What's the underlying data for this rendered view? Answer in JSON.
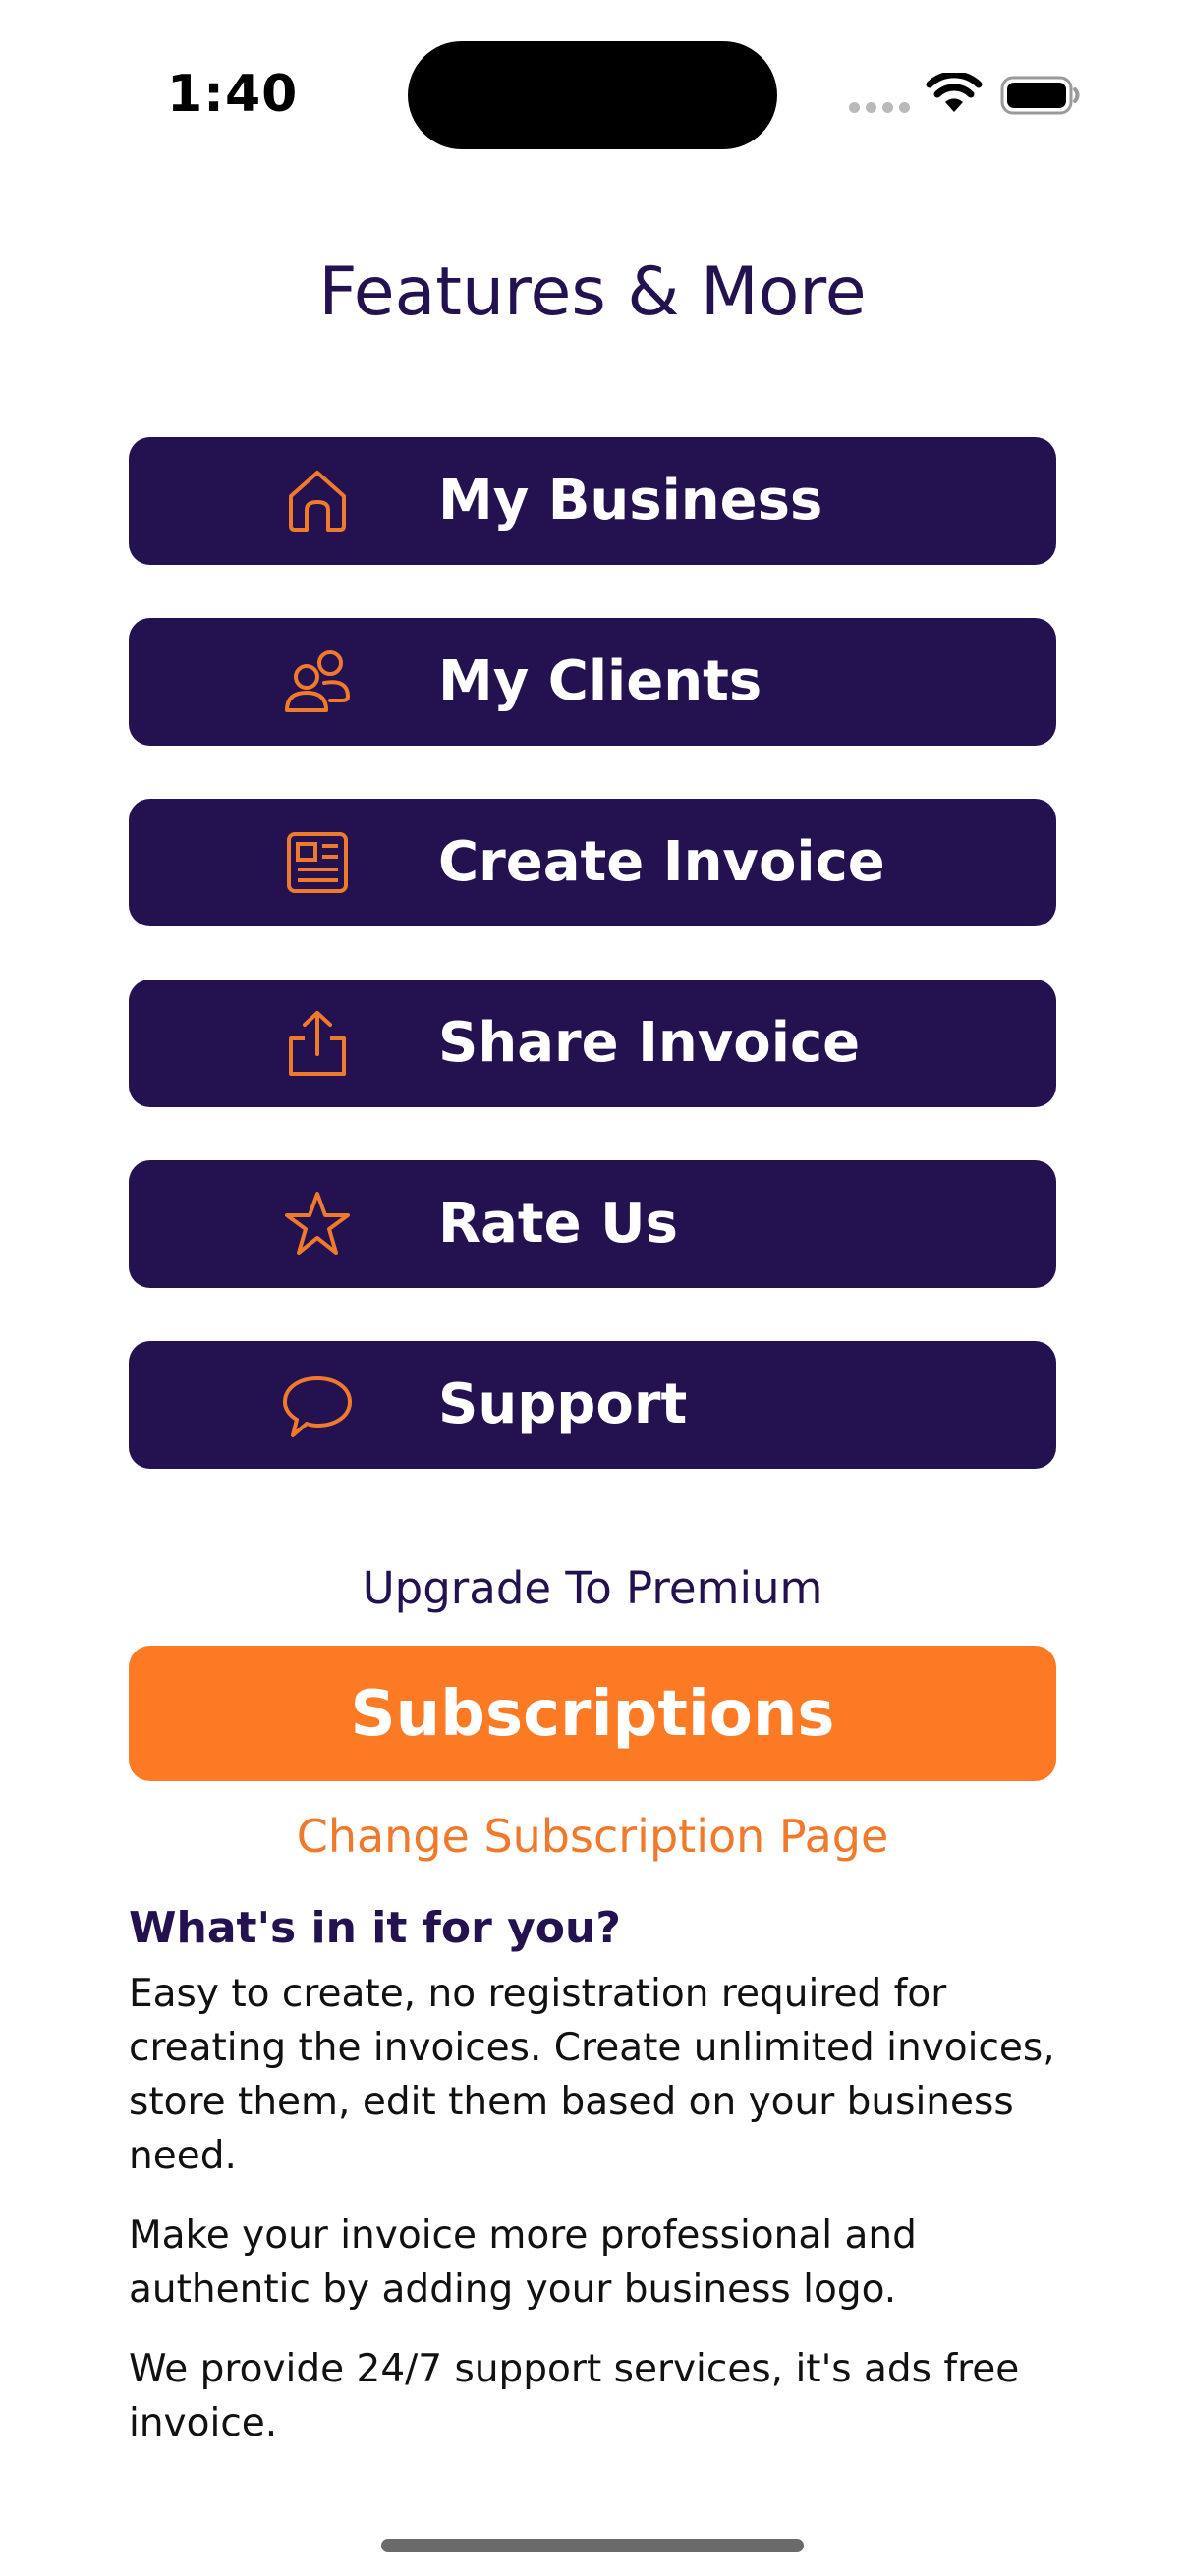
{
  "status_bar": {
    "time": "1:40"
  },
  "title": "Features & More",
  "menu": [
    {
      "label": "My Business",
      "icon": "home-icon"
    },
    {
      "label": "My Clients",
      "icon": "users-icon"
    },
    {
      "label": "Create Invoice",
      "icon": "invoice-icon"
    },
    {
      "label": "Share Invoice",
      "icon": "share-icon"
    },
    {
      "label": "Rate Us",
      "icon": "star-icon"
    },
    {
      "label": "Support",
      "icon": "chat-bubble-icon"
    }
  ],
  "upgrade_text": "Upgrade To Premium",
  "subscribe_label": "Subscriptions",
  "change_subscription_label": "Change Subscription Page",
  "info": {
    "heading": "What's in it for you?",
    "paragraphs": [
      "Easy to create, no registration required for creating the invoices. Create unlimited invoices, store them, edit them based on your business need.",
      "Make your invoice more professional and authentic by adding your business logo.",
      "We provide 24/7 support services, it's ads free invoice."
    ]
  },
  "colors": {
    "primary": "#241150",
    "accent": "#fd7a25",
    "link": "#f07a2c",
    "icon": "#f07a2c"
  }
}
